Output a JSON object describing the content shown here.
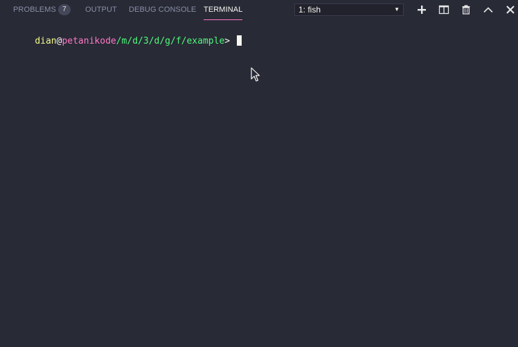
{
  "tabs": {
    "problems": {
      "label": "PROBLEMS",
      "count": "7"
    },
    "output": {
      "label": "OUTPUT"
    },
    "debug_console": {
      "label": "DEBUG CONSOLE"
    },
    "terminal": {
      "label": "TERMINAL"
    }
  },
  "terminal_select": {
    "selected": "1: fish"
  },
  "actions": [
    "plus-icon",
    "split-icon",
    "trash-icon",
    "chevron-up-icon",
    "close-icon"
  ],
  "prompt": {
    "user": "dian",
    "at": "@",
    "host": "petanikode",
    "path": "/m/d/3/d/g/f/example",
    "symbol": "> "
  },
  "colors": {
    "background": "#282a36",
    "accent": "#ff79c6",
    "user": "#f1fa8c",
    "host": "#ff79c6",
    "path": "#50fa7b",
    "text": "#f8f8f2"
  }
}
